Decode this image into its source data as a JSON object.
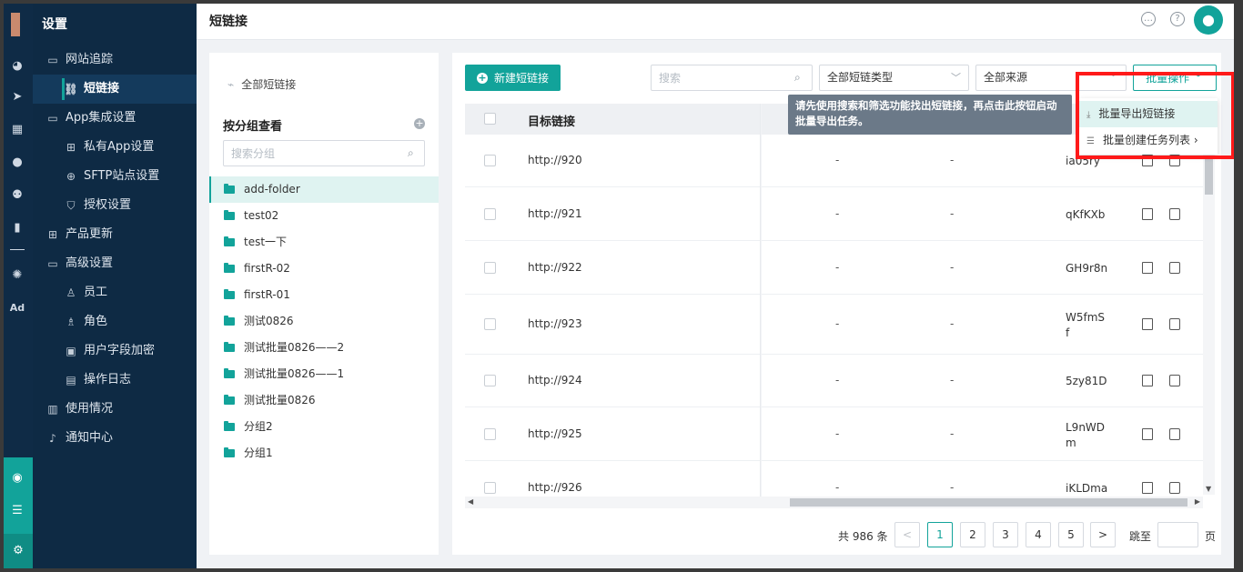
{
  "sidebar": {
    "title": "设置",
    "items": [
      {
        "label": "网站追踪",
        "icon": "folder-icon",
        "level": 0
      },
      {
        "label": "短链接",
        "icon": "link-icon",
        "level": 1,
        "active": true
      },
      {
        "label": "App集成设置",
        "icon": "folder-icon",
        "level": 0
      },
      {
        "label": "私有App设置",
        "icon": "app-grid-icon",
        "level": 1
      },
      {
        "label": "SFTP站点设置",
        "icon": "globe-icon",
        "level": 1
      },
      {
        "label": "授权设置",
        "icon": "shield-icon",
        "level": 1
      },
      {
        "label": "产品更新",
        "icon": "grid-icon",
        "level": 0
      },
      {
        "label": "高级设置",
        "icon": "folder-icon",
        "level": 0
      },
      {
        "label": "员工",
        "icon": "user-icon",
        "level": 1
      },
      {
        "label": "角色",
        "icon": "role-icon",
        "level": 1
      },
      {
        "label": "用户字段加密",
        "icon": "encrypt-icon",
        "level": 1
      },
      {
        "label": "操作日志",
        "icon": "log-icon",
        "level": 1
      },
      {
        "label": "使用情况",
        "icon": "usage-icon",
        "level": 0
      },
      {
        "label": "通知中心",
        "icon": "bell-icon",
        "level": 0
      }
    ]
  },
  "rail": {
    "ad_label": "Ad"
  },
  "header": {
    "title": "短链接"
  },
  "groups": {
    "all_label": "全部短链接",
    "title": "按分组查看",
    "search_placeholder": "搜索分组",
    "folders": [
      "add-folder",
      "test02",
      "test一下",
      "firstR-02",
      "firstR-01",
      "测试0826",
      "测试批量0826——2",
      "测试批量0826——1",
      "测试批量0826",
      "分组2",
      "分组1"
    ]
  },
  "toolbar": {
    "new_label": "新建短链接",
    "search_placeholder": "搜索",
    "type_select": "全部短链类型",
    "source_select": "全部来源",
    "batch_label": "批量操作"
  },
  "table": {
    "header_target": "目标链接",
    "rows": [
      {
        "url": "http://920",
        "c1": "-",
        "c2": "-",
        "code": "ia05ry"
      },
      {
        "url": "http://921",
        "c1": "-",
        "c2": "-",
        "code": "qKfKXb"
      },
      {
        "url": "http://922",
        "c1": "-",
        "c2": "-",
        "code": "GH9r8n"
      },
      {
        "url": "http://923",
        "c1": "-",
        "c2": "-",
        "code": "W5fmS\nf"
      },
      {
        "url": "http://924",
        "c1": "-",
        "c2": "-",
        "code": "5zy81D"
      },
      {
        "url": "http://925",
        "c1": "-",
        "c2": "-",
        "code": "L9nWD\nm"
      },
      {
        "url": "http://926",
        "c1": "-",
        "c2": "-",
        "code": "iKLDma"
      }
    ]
  },
  "pagination": {
    "total": "共 986 条",
    "pages": [
      "1",
      "2",
      "3",
      "4",
      "5"
    ],
    "prev": "<",
    "next": ">",
    "goto_label": "跳至",
    "goto_unit": "页",
    "current": "1"
  },
  "tooltip": {
    "text": "请先使用搜索和筛选功能找出短链接，再点击此按钮启动批量导出任务。"
  },
  "dropdown": {
    "items": [
      {
        "label": "批量导出短链接"
      },
      {
        "label": "批量创建任务列表"
      }
    ]
  },
  "colors": {
    "accent": "#12a39a",
    "sidebar": "#0e2a44",
    "highlight": "#ff1a1a"
  }
}
